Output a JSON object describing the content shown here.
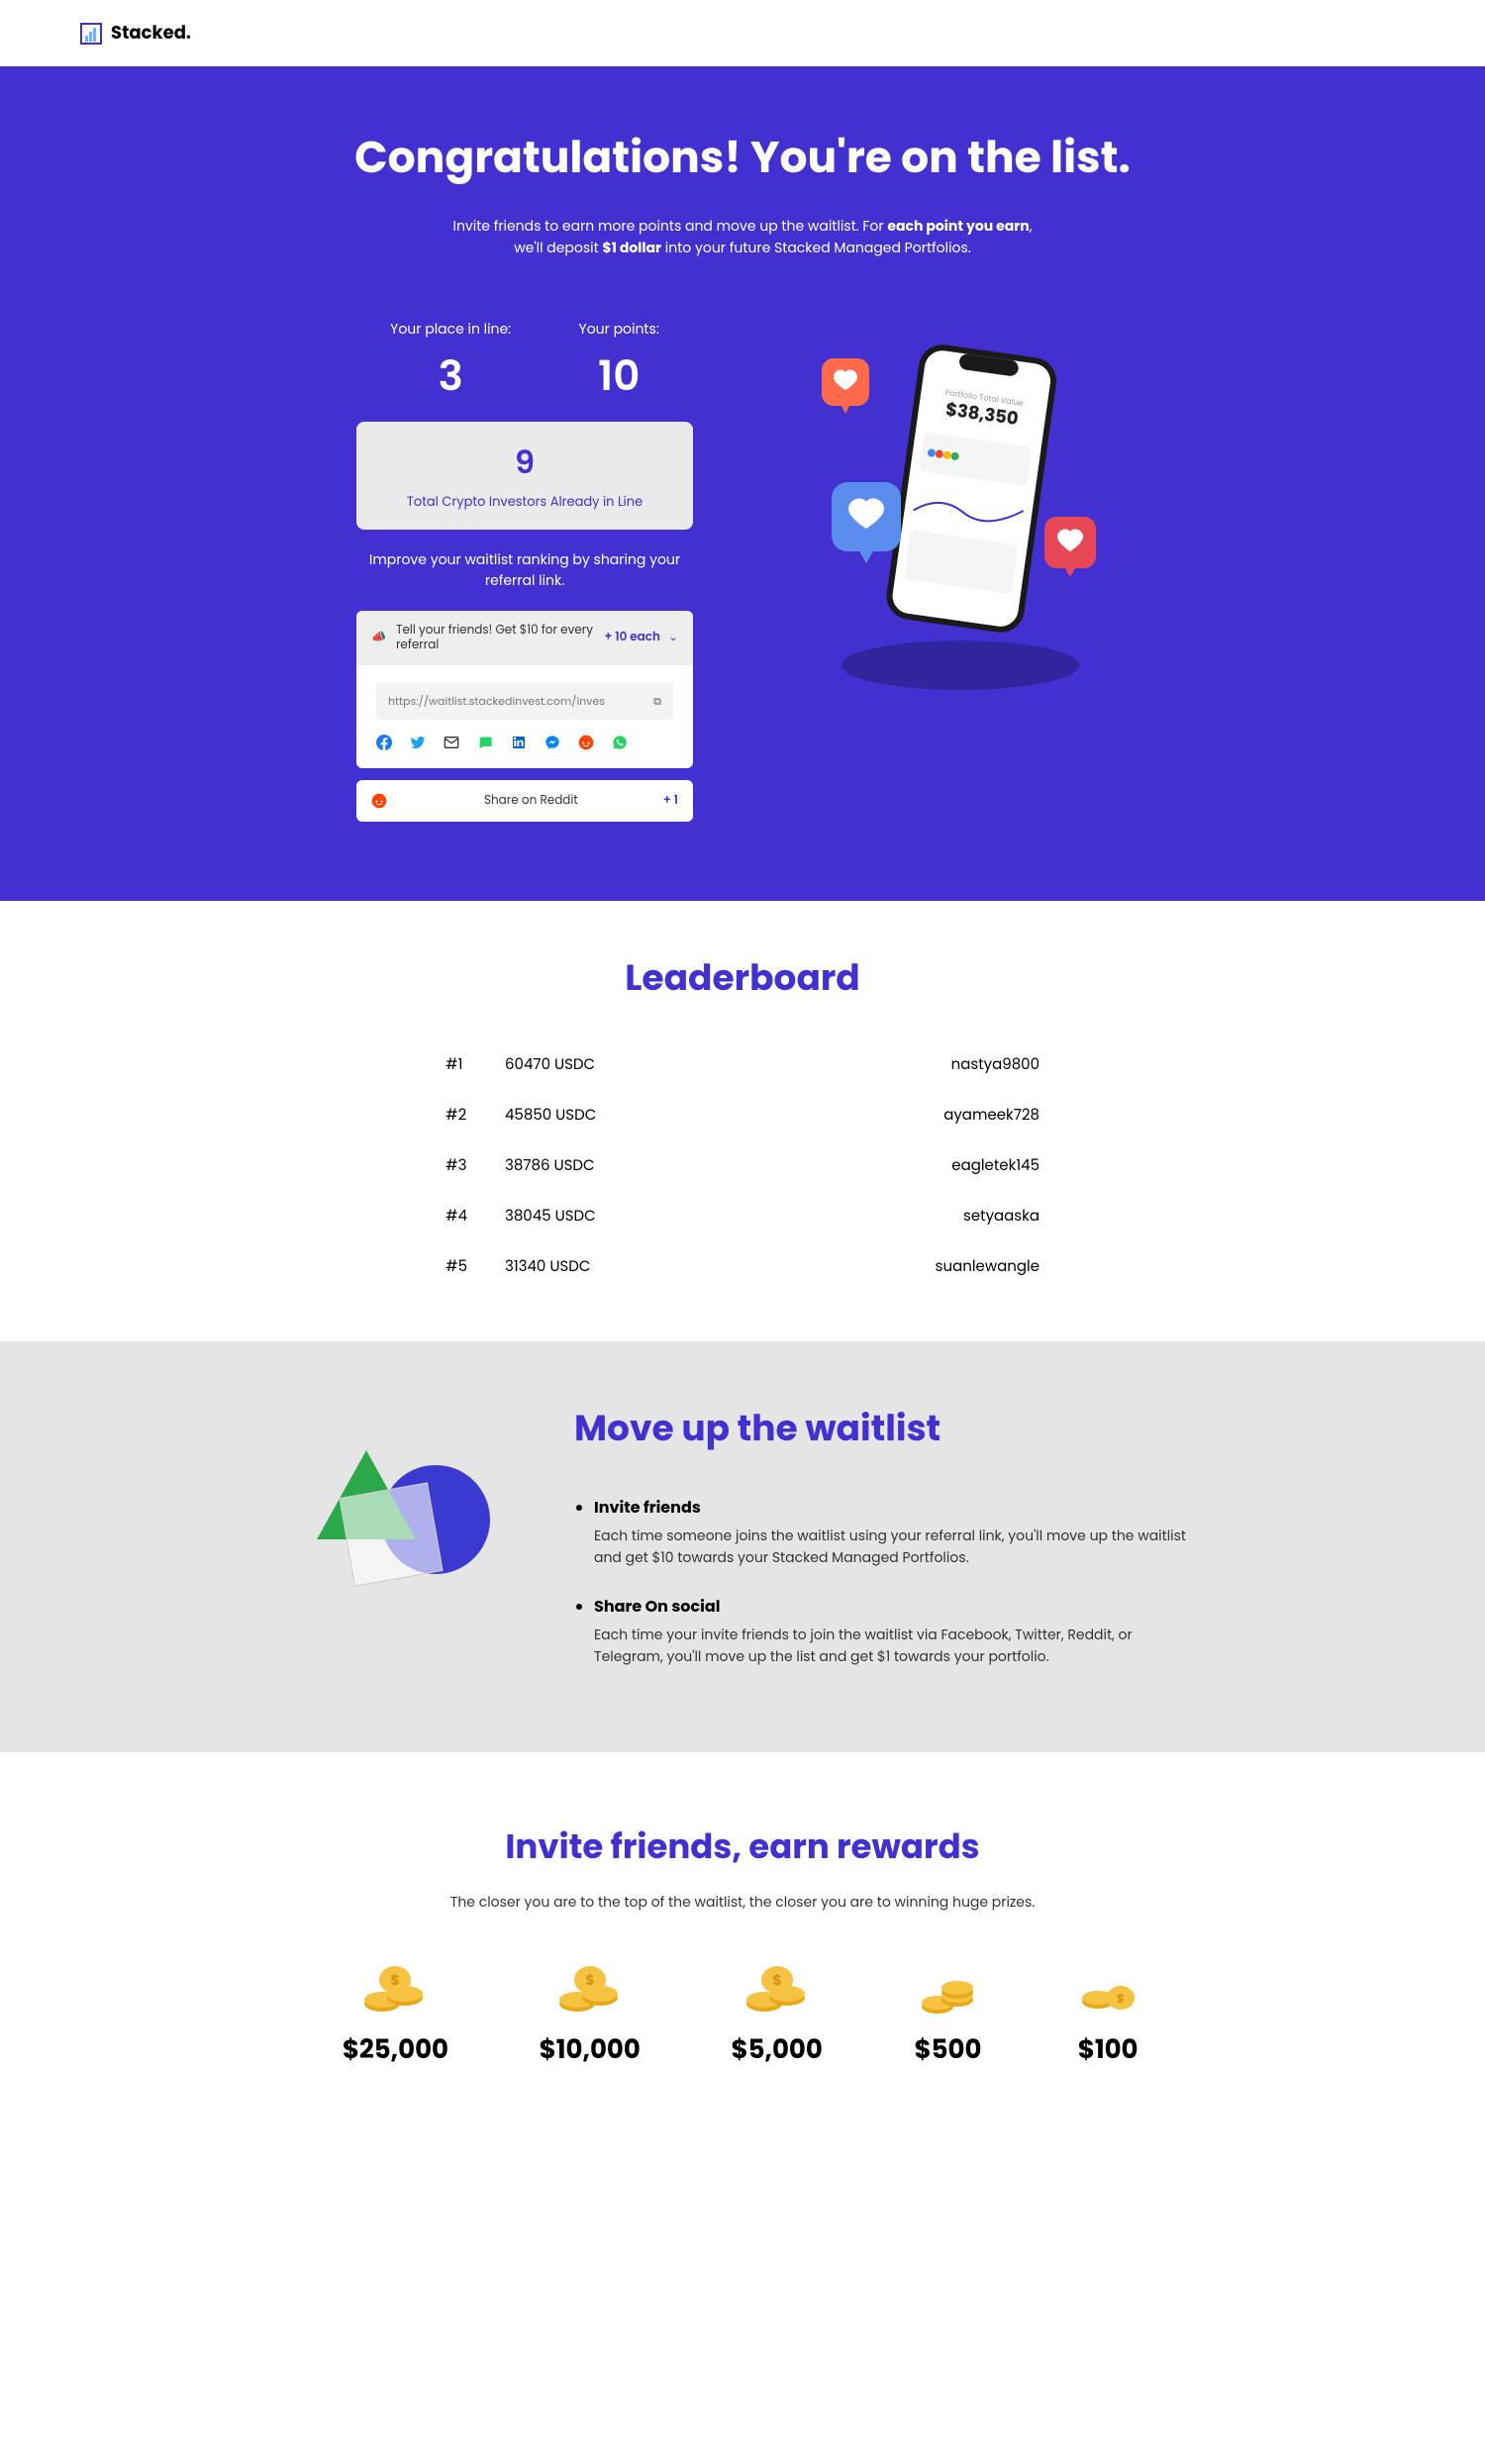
{
  "brand": "Stacked.",
  "hero": {
    "title": "Congratulations! You're on the list.",
    "sub_pre": "Invite friends to earn more points and move up the waitlist. For ",
    "sub_bold1": "each point you earn",
    "sub_mid": ", we'll deposit ",
    "sub_bold2": "$1 dollar",
    "sub_post": " into your future Stacked Managed Portfolios."
  },
  "stats": {
    "place_label": "Your place in line:",
    "place_value": "3",
    "points_label": "Your points:",
    "points_value": "10",
    "investors_value": "9",
    "investors_label": "Total Crypto Investors Already in Line",
    "improve": "Improve your waitlist ranking by sharing your referral link."
  },
  "share": {
    "header_text": "Tell your friends! Get $10 for every referral",
    "header_bonus": "+ 10 each",
    "url": "https://waitlist.stackedinvest.com/inves"
  },
  "reddit": {
    "text": "Share on Reddit",
    "bonus": "+ 1"
  },
  "leaderboard": {
    "title": "Leaderboard",
    "rows": [
      {
        "rank": "#1",
        "amount": "60470 USDC",
        "user": "nastya9800"
      },
      {
        "rank": "#2",
        "amount": "45850 USDC",
        "user": "ayameek728"
      },
      {
        "rank": "#3",
        "amount": "38786 USDC",
        "user": "eagletek145"
      },
      {
        "rank": "#4",
        "amount": "38045 USDC",
        "user": "setyaaska"
      },
      {
        "rank": "#5",
        "amount": "31340 USDC",
        "user": "suanlewangle"
      }
    ]
  },
  "moveup": {
    "title": "Move up the waitlist",
    "items": [
      {
        "heading": "Invite friends",
        "body": "Each time someone joins the waitlist using your referral link, you'll move up the waitlist and get $10 towards your Stacked Managed Portfolios."
      },
      {
        "heading": "Share On social",
        "body": "Each time your invite friends to join the waitlist via Facebook, Twitter, Reddit, or Telegram, you'll move up the list and get $1 towards your portfolio."
      }
    ]
  },
  "rewards": {
    "title": "Invite friends, earn rewards",
    "sub": "The closer you are to the top of the waitlist, the closer you are to winning huge prizes.",
    "tiers": [
      "$25,000",
      "$10,000",
      "$5,000",
      "$500",
      "$100"
    ]
  }
}
